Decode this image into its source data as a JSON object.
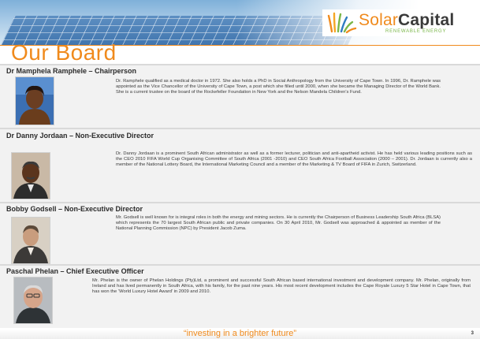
{
  "slide": {
    "title": "Our Board",
    "tagline": "“investing in a brighter future”",
    "page_number": "3"
  },
  "logo": {
    "word1": "Solar",
    "word2": "Capital",
    "subtitle": "RENEWABLE ENERGY"
  },
  "colors": {
    "accent": "#f08a1c",
    "logo_green": "#7ab648",
    "row_bg": "#f2f2f2"
  },
  "board": [
    {
      "name": "Dr Mamphela Ramphele – Chairperson",
      "bio": "Dr. Ramphele qualified as a medical doctor in 1972.  She also holds a PhD in Social Anthropology from the University of Cape Town.  In 1996, Dr. Ramphele was appointed as the  Vice Chancellor of the University of Cape Town, a post which she filled until 2000, when she became the Managing Director of the World Bank. She is a current trustee on the board of the Rockefeller Foundation in New York and the Nelson Mandela Children’s Fund."
    },
    {
      "name": "Dr Danny Jordaan – Non-Executive Director",
      "bio": "Dr. Danny Jordaan is a prominent South African administrator as well as a former lecturer, politician and anti-apartheid activist. He has held various leading positions such as the CEO 2010 FIFA World Cup Organising Committee of South Africa (2001 -2010) and CEO South Africa Football Association (2000 – 2001). Dr. Jordaan is currently also a member of the National Lottery Board, the International Marketing Council and a  member of the Marketing & TV Board of FIFA in Zurich, Switzerland."
    },
    {
      "name": "Bobby Godsell – Non-Executive Director",
      "bio": "Mr. Godsell is well known for is integral roles in both the energy and mining sectors. He is currently the Chairperson of Business Leadership South Africa (BLSA) which represents the 70 largest South African public and private companies. On 30 April 2010, Mr. Godsell was approached & appointed as member of the National Planning Commission (NPC) by President Jacob Zuma."
    },
    {
      "name": "Paschal Phelan – Chief Executive Officer",
      "bio": "Mr. Phelan is the owner of Phelan Holdings (Pty)Ltd, a prominent and successful South African based international investment and development company.  Mr. Phelan, originally from Ireland and has lived permanently in South Africa, with his family, for the past nine years. His most recent development includes the Cape Royale Luxury 5 Star Hotel in Cape Town, that has won the ‘World Luxury Hotel Award’ in 2009 and 2010."
    }
  ]
}
